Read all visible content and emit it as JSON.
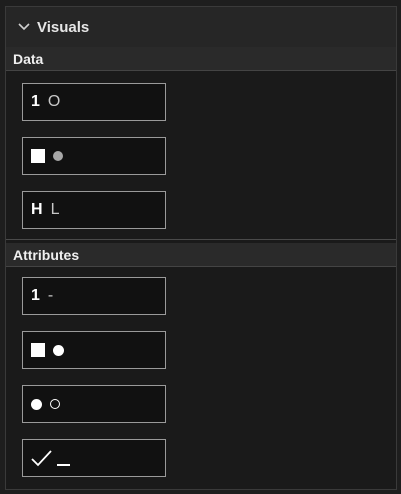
{
  "panel": {
    "title": "Visuals",
    "expanded": true
  },
  "sections": {
    "data": {
      "label": "Data",
      "buttons": [
        {
          "glyph_a": "1",
          "glyph_b": "O"
        },
        {
          "icon_a": "square-icon",
          "icon_b": "filled-circle-grey-icon"
        },
        {
          "glyph_a": "H",
          "glyph_b": "L"
        }
      ]
    },
    "attributes": {
      "label": "Attributes",
      "buttons": [
        {
          "glyph_a": "1",
          "glyph_b": "-"
        },
        {
          "icon_a": "square-icon",
          "icon_b": "filled-circle-icon"
        },
        {
          "icon_a": "filled-circle-icon",
          "icon_b": "hollow-circle-icon"
        },
        {
          "icon_a": "checkmark-icon",
          "icon_b": "underscore-icon"
        }
      ]
    }
  },
  "colors": {
    "background": "#1a1a1a",
    "header": "#262626",
    "section_bar": "#2a2a2a",
    "button_border": "#9a9a9a",
    "glyph": "#ffffff",
    "muted_glyph": "#a8a8a8"
  }
}
